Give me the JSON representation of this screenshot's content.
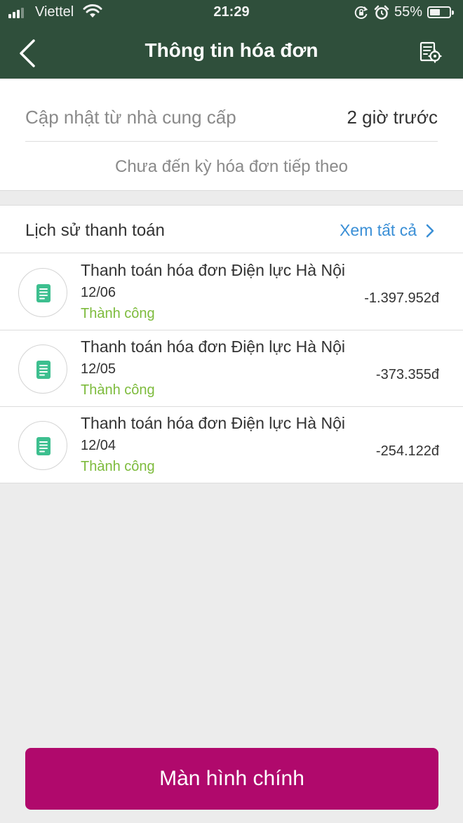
{
  "status_bar": {
    "carrier": "Viettel",
    "time": "21:29",
    "battery_percent_label": "55%",
    "battery_level": 0.55,
    "icons": [
      "signal-icon",
      "wifi-icon",
      "orientation-lock-icon",
      "alarm-icon",
      "battery-icon"
    ]
  },
  "nav": {
    "title": "Thông tin hóa đơn",
    "back_icon": "chevron-left-icon",
    "settings_icon": "bill-settings-icon"
  },
  "bill_info": {
    "update_label": "Cập nhật từ nhà cung cấp",
    "update_value": "2 giờ trước",
    "next_bill_text": "Chưa đến kỳ hóa đơn tiếp theo"
  },
  "history": {
    "title": "Lịch sử thanh toán",
    "see_all_label": "Xem tất cả",
    "items": [
      {
        "title": "Thanh toán hóa đơn Điện lực Hà Nội",
        "date": "12/06",
        "status": "Thành công",
        "amount": "-1.397.952đ"
      },
      {
        "title": "Thanh toán hóa đơn Điện lực Hà Nội",
        "date": "12/05",
        "status": "Thành công",
        "amount": "-373.355đ"
      },
      {
        "title": "Thanh toán hóa đơn Điện lực Hà Nội",
        "date": "12/04",
        "status": "Thành công",
        "amount": "-254.122đ"
      }
    ]
  },
  "main_button_label": "Màn hình chính",
  "colors": {
    "header": "#2f4f3b",
    "accent_button": "#b0096c",
    "link": "#3a8fd6",
    "success": "#7dbb3c",
    "document_icon": "#3dbf8f"
  }
}
